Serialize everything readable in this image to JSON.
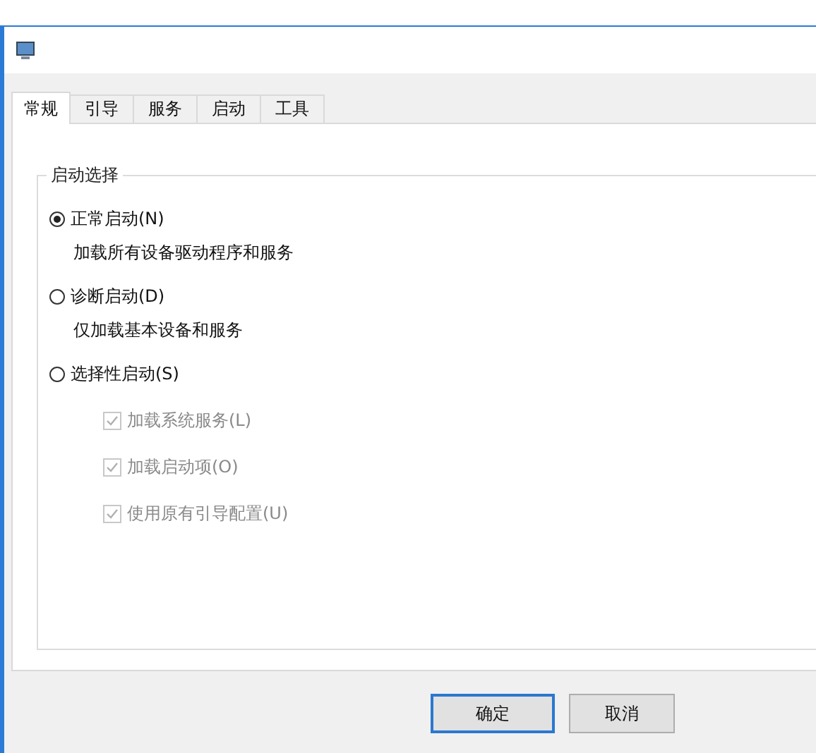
{
  "tabs": [
    {
      "label": "常规",
      "selected": true
    },
    {
      "label": "引导",
      "selected": false
    },
    {
      "label": "服务",
      "selected": false
    },
    {
      "label": "启动",
      "selected": false
    },
    {
      "label": "工具",
      "selected": false
    }
  ],
  "group": {
    "title": "启动选择",
    "options": [
      {
        "label": "正常启动(N)",
        "selected": true,
        "description": "加载所有设备驱动程序和服务"
      },
      {
        "label": "诊断启动(D)",
        "selected": false,
        "description": "仅加载基本设备和服务"
      },
      {
        "label": "选择性启动(S)",
        "selected": false
      }
    ],
    "checkboxes": [
      {
        "label": "加载系统服务(L)",
        "checked": true,
        "disabled": true
      },
      {
        "label": "加载启动项(O)",
        "checked": true,
        "disabled": true
      },
      {
        "label": "使用原有引导配置(U)",
        "checked": true,
        "disabled": true
      }
    ]
  },
  "buttons": [
    {
      "label": "确定",
      "default": true
    },
    {
      "label": "取消",
      "default": false
    }
  ]
}
